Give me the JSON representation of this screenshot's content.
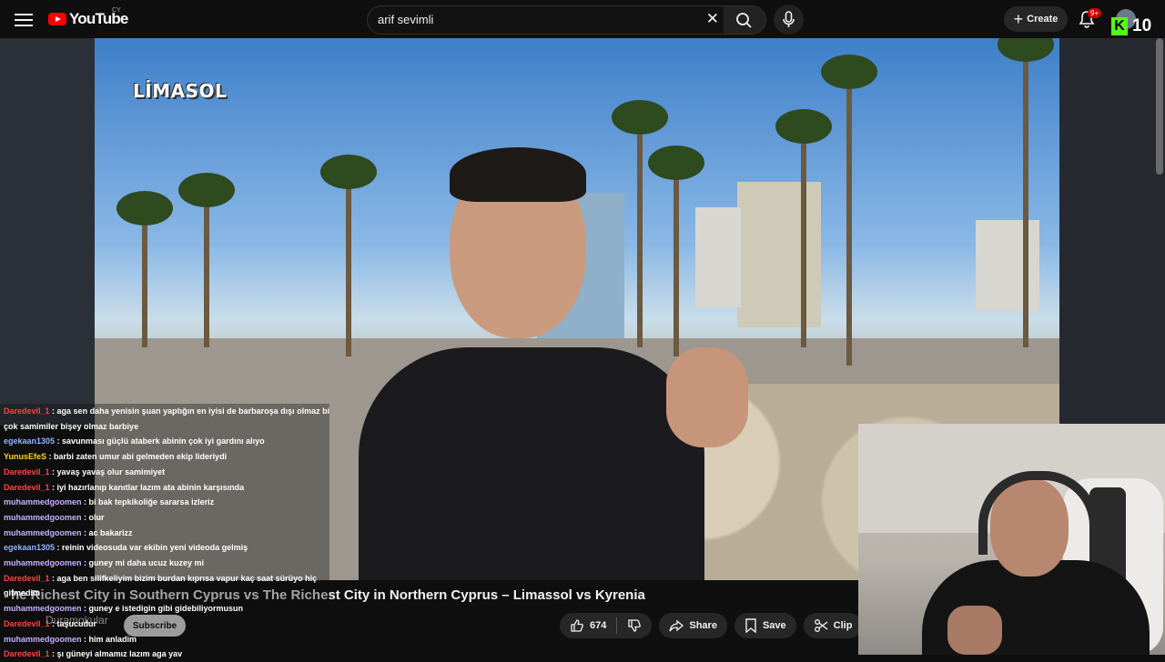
{
  "header": {
    "logo_text": "YouTube",
    "country_code": "CY",
    "search_value": "arif sevimli",
    "create_label": "Create",
    "notification_badge": "9+"
  },
  "kick_overlay": {
    "count": "10",
    "brand_color": "#53fc18"
  },
  "video": {
    "caption": "LİMASOL",
    "title": "he Richest City in Southern Cyprus vs The Richest City in Northern Cyprus – Limassol vs Kyrenia",
    "channel_name": "Duramokular",
    "subscribe_label": "Subscribe",
    "like_count": "674",
    "share_label": "Share",
    "save_label": "Save",
    "clip_label": "Clip"
  },
  "chat": [
    {
      "user": "Daredevil_1",
      "color": "#ff4444",
      "text": "aga sen daha yenisin şuan yaptığın en iyisi de barbaroşa dışı olmaz bide"
    },
    {
      "user": "",
      "color": "#ffffff",
      "text": "çok samimiler bişey olmaz barbiye"
    },
    {
      "user": "egekaan1305",
      "color": "#8fb4ff",
      "text": "savunması güçlü ataberk abinin çok iyi gardını alıyo"
    },
    {
      "user": "YunusEfeS",
      "color": "#ffd21f",
      "text": "barbi zaten umur abi gelmeden ekip lideriydi"
    },
    {
      "user": "Daredevil_1",
      "color": "#ff4444",
      "text": "yavaş yavaş olur samimiyet"
    },
    {
      "user": "Daredevil_1",
      "color": "#ff4444",
      "text": "iyi hazırlanıp kanıtlar lazım ata abinin karşısında"
    },
    {
      "user": "muhammedgoomen",
      "color": "#c9b0ff",
      "text": "bi bak tepkikoliğe sararsa izleriz"
    },
    {
      "user": "muhammedgoomen",
      "color": "#c9b0ff",
      "text": "olur"
    },
    {
      "user": "muhammedgoomen",
      "color": "#c9b0ff",
      "text": "ac bakarizz"
    },
    {
      "user": "egekaan1305",
      "color": "#8fb4ff",
      "text": "reinin videosuda var ekibin yeni videoda gelmiş"
    },
    {
      "user": "muhammedgoomen",
      "color": "#c9b0ff",
      "text": "guney mi daha ucuz kuzey mi"
    },
    {
      "user": "Daredevil_1",
      "color": "#ff4444",
      "text": "aga ben silifkeliyim bizim burdan kıprısa vapur kaç saat sürüyo hiç"
    },
    {
      "user": "",
      "color": "#ffffff",
      "text": "gitmedim"
    },
    {
      "user": "muhammedgoomen",
      "color": "#c9b0ff",
      "text": "guney e istedigin gibi gidebiliyormusun"
    },
    {
      "user": "Daredevil_1",
      "color": "#ff4444",
      "text": "taşucudur"
    },
    {
      "user": "muhammedgoomen",
      "color": "#c9b0ff",
      "text": "him anladim"
    },
    {
      "user": "Daredevil_1",
      "color": "#ff4444",
      "text": "şı güneyi almamız lazım aga yav"
    }
  ]
}
